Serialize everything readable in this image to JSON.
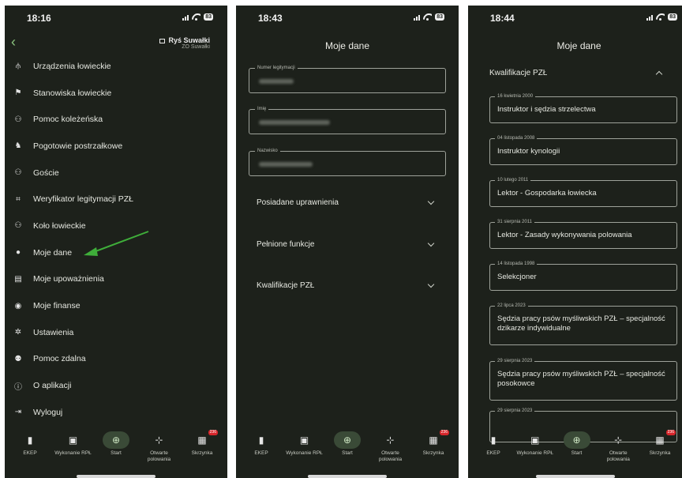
{
  "screens": [
    {
      "time": "18:16",
      "battery": "83",
      "club": {
        "name": "Ryś Suwałki",
        "sub": "ZO Suwałki"
      },
      "menu": [
        {
          "label": "Urządzenia łowieckie",
          "icon": "tower-icon",
          "glyph": "⫛"
        },
        {
          "label": "Stanowiska łowieckie",
          "icon": "flag-icon",
          "glyph": "⚑"
        },
        {
          "label": "Pomoc koleżeńska",
          "icon": "group-icon",
          "glyph": "⚇"
        },
        {
          "label": "Pogotowie postrzałkowe",
          "icon": "dog-icon",
          "glyph": "♞"
        },
        {
          "label": "Goście",
          "icon": "guests-icon",
          "glyph": "⚇"
        },
        {
          "label": "Weryfikator legitymacji PZŁ",
          "icon": "scan-icon",
          "glyph": "⌗"
        },
        {
          "label": "Koło łowieckie",
          "icon": "club-icon",
          "glyph": "⚇"
        },
        {
          "label": "Moje dane",
          "icon": "person-icon",
          "glyph": "●"
        },
        {
          "label": "Moje upoważnienia",
          "icon": "document-icon",
          "glyph": "▤"
        },
        {
          "label": "Moje finanse",
          "icon": "piggy-bank-icon",
          "glyph": "◉"
        },
        {
          "label": "Ustawienia",
          "icon": "gear-icon",
          "glyph": "✲"
        },
        {
          "label": "Pomoc zdalna",
          "icon": "support-icon",
          "glyph": "⚉"
        },
        {
          "label": "O aplikacji",
          "icon": "info-icon",
          "glyph": "ⓘ"
        },
        {
          "label": "Wyloguj",
          "icon": "logout-icon",
          "glyph": "⇥"
        }
      ]
    },
    {
      "time": "18:43",
      "battery": "83",
      "title": "Moje dane",
      "fields": [
        {
          "label": "Numer legitymacji",
          "value": ""
        },
        {
          "label": "Imię",
          "value": ""
        },
        {
          "label": "Nazwisko",
          "value": ""
        }
      ],
      "sections": [
        {
          "label": "Posiadane uprawnienia"
        },
        {
          "label": "Pełnione funkcje"
        },
        {
          "label": "Kwalifikacje PZŁ"
        }
      ]
    },
    {
      "time": "18:44",
      "battery": "83",
      "title": "Moje dane",
      "section": "Kwalifikacje PZŁ",
      "qualifications": [
        {
          "date": "16 kwietnia 2000",
          "text": "Instruktor i sędzia strzelectwa"
        },
        {
          "date": "04 listopada 2008",
          "text": "Instruktor kynologii"
        },
        {
          "date": "10 lutego 2011",
          "text": "Lektor - Gospodarka łowiecka"
        },
        {
          "date": "31 sierpnia 2011",
          "text": "Lektor - Zasady wykonywania polowania"
        },
        {
          "date": "14 listopada 1998",
          "text": "Selekcjoner"
        },
        {
          "date": "22 lipca 2023",
          "text": "Sędzia pracy psów myśliwskich PZŁ – specjalność dzikarze indywidualne"
        },
        {
          "date": "29 sierpnia 2023",
          "text": "Sędzia pracy psów myśliwskich PZŁ – specjalność posokowce"
        },
        {
          "date": "29 sierpnia 2023",
          "text": ""
        }
      ]
    }
  ],
  "bottom_nav": [
    {
      "label": "EKEP",
      "icon": "ekep-icon",
      "glyph": "▮"
    },
    {
      "label": "Wykonanie RPŁ",
      "icon": "calendar-icon",
      "glyph": "▣"
    },
    {
      "label": "Start",
      "icon": "start-icon",
      "glyph": "⊕"
    },
    {
      "label": "Otwarte polowania",
      "icon": "crosshair-icon",
      "glyph": "⊹"
    },
    {
      "label": "Skrzynka",
      "icon": "inbox-icon",
      "glyph": "▦",
      "badge": "236"
    }
  ],
  "colors": {
    "background": "#1d211b",
    "accent": "#3fae3a",
    "nav_active": "#3a4a37",
    "badge": "#d7262b"
  }
}
